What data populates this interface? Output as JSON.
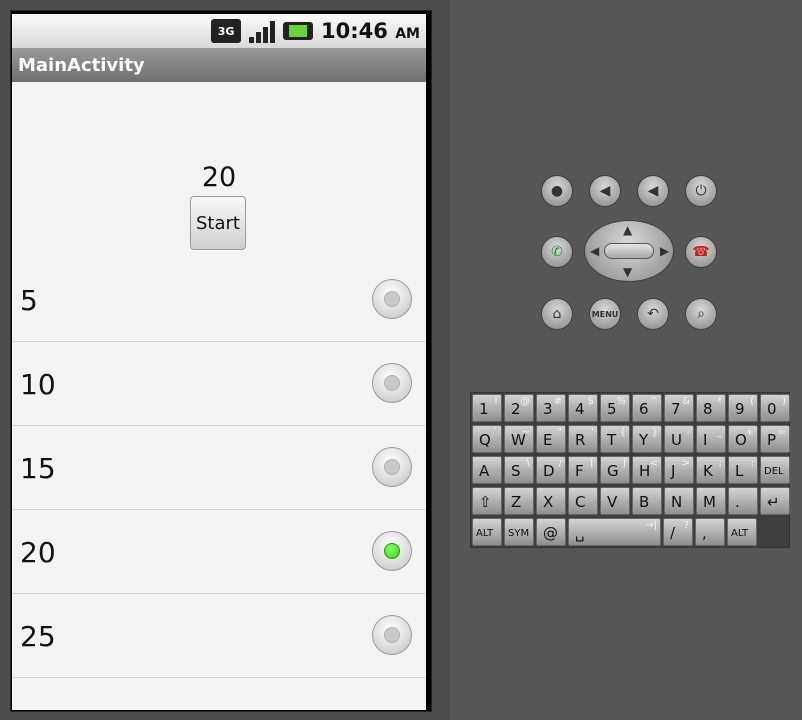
{
  "status_bar": {
    "network_label": "3G",
    "clock": "10:46",
    "ampm": "AM"
  },
  "title_bar": {
    "title": "MainActivity"
  },
  "content": {
    "counter_value": "20",
    "start_label": "Start",
    "options": [
      {
        "label": "5",
        "selected": false
      },
      {
        "label": "10",
        "selected": false
      },
      {
        "label": "15",
        "selected": false
      },
      {
        "label": "20",
        "selected": true
      },
      {
        "label": "25",
        "selected": false
      }
    ]
  },
  "controls": {
    "icons": [
      "camera-icon",
      "volume-down-icon",
      "volume-up-icon",
      "power-icon",
      "call-icon",
      "end-call-icon",
      "home-icon",
      "menu-icon",
      "back-icon",
      "search-icon"
    ],
    "menu_label": "MENU"
  },
  "keyboard": {
    "rows": [
      [
        [
          "1",
          "!"
        ],
        [
          "2",
          "@"
        ],
        [
          "3",
          "#"
        ],
        [
          "4",
          "$"
        ],
        [
          "5",
          "%"
        ],
        [
          "6",
          "^"
        ],
        [
          "7",
          "&"
        ],
        [
          "8",
          "*"
        ],
        [
          "9",
          "("
        ],
        [
          "0",
          ")"
        ]
      ],
      [
        [
          "Q",
          "`"
        ],
        [
          "W",
          "~"
        ],
        [
          "E",
          "\""
        ],
        [
          "R",
          "'"
        ],
        [
          "T",
          "{"
        ],
        [
          "Y",
          "}"
        ],
        [
          "U",
          "-"
        ],
        [
          "I",
          "_"
        ],
        [
          "O",
          "+"
        ],
        [
          "P",
          "="
        ]
      ],
      [
        [
          "A",
          ""
        ],
        [
          "S",
          "\\"
        ],
        [
          "D",
          "/"
        ],
        [
          "F",
          "["
        ],
        [
          "G",
          "]"
        ],
        [
          "H",
          "<"
        ],
        [
          "J",
          ">"
        ],
        [
          "K",
          ";"
        ],
        [
          "L",
          ":"
        ],
        [
          "DEL",
          ""
        ]
      ],
      [
        [
          "⇧",
          ""
        ],
        [
          "Z",
          ""
        ],
        [
          "X",
          ""
        ],
        [
          "C",
          ""
        ],
        [
          "V",
          ""
        ],
        [
          "B",
          ""
        ],
        [
          "N",
          ""
        ],
        [
          "M",
          ""
        ],
        [
          ".",
          ""
        ],
        [
          "↵",
          ""
        ]
      ],
      [
        [
          "ALT",
          ""
        ],
        [
          "SYM",
          ""
        ],
        [
          "@",
          ""
        ],
        [
          "␣",
          "→|"
        ],
        [
          "/",
          "?"
        ],
        [
          ",",
          ""
        ],
        [
          "ALT",
          ""
        ]
      ]
    ]
  }
}
